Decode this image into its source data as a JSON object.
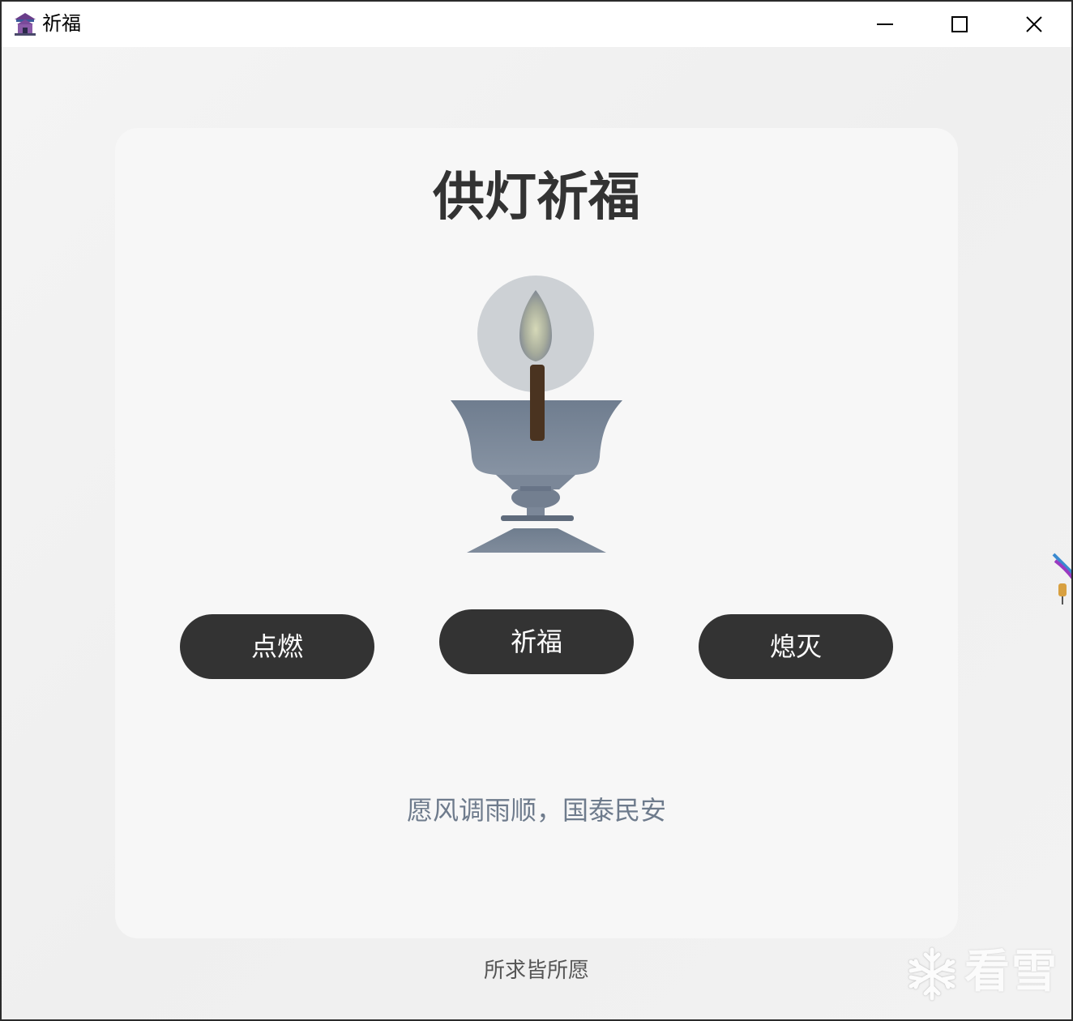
{
  "window": {
    "title": "祈福",
    "app_icon": "temple-icon",
    "controls": {
      "minimize": "minimize-icon",
      "maximize": "maximize-icon",
      "close": "close-icon"
    }
  },
  "card": {
    "title": "供灯祈福",
    "lamp_icon": "oil-lamp-icon",
    "buttons": {
      "light": "点燃",
      "pray": "祈福",
      "extinguish": "熄灭"
    },
    "wish": "愿风调雨顺，国泰民安"
  },
  "footer": {
    "text": "所求皆所愿"
  },
  "watermark": {
    "text": "看雪",
    "icon": "snowflake-icon"
  },
  "colors": {
    "button_bg": "#333333",
    "title_text": "#333333",
    "wish_text": "#6e7b8c",
    "card_bg": "#f7f7f7",
    "lamp_body": "#7d8a9b",
    "candle": "#4a3320"
  }
}
